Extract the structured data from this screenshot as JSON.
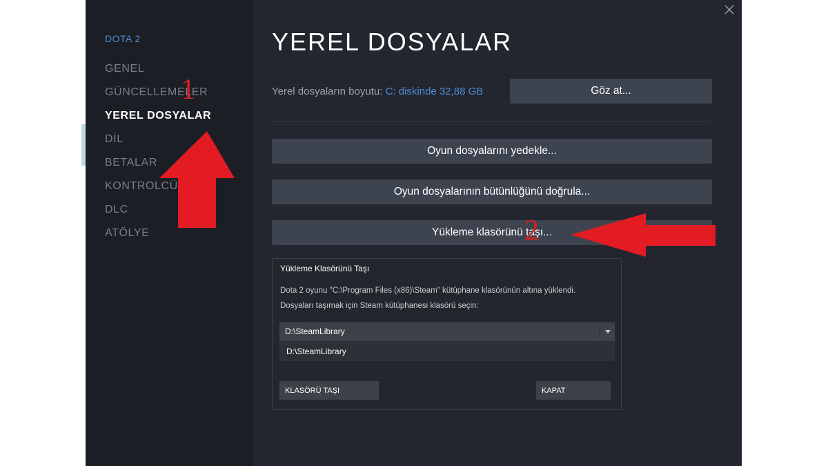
{
  "sidebar": {
    "game_name": "DOTA 2",
    "items": [
      {
        "label": "GENEL"
      },
      {
        "label": "GÜNCELLEMELER"
      },
      {
        "label": "YEREL DOSYALAR"
      },
      {
        "label": "DİL"
      },
      {
        "label": "BETALAR"
      },
      {
        "label": "KONTROLCÜ"
      },
      {
        "label": "DLC"
      },
      {
        "label": "ATÖLYE"
      }
    ]
  },
  "main": {
    "title": "YEREL DOSYALAR",
    "size_label": "Yerel dosyaların boyutu:",
    "size_value": "C: diskinde 32,88 GB",
    "browse_button": "Göz at...",
    "backup_button": "Oyun dosyalarını yedekle...",
    "verify_button": "Oyun dosyalarının bütünlüğünü doğrula...",
    "move_button": "Yükleme klasörünü taşı..."
  },
  "dialog": {
    "title": "Yükleme Klasörünü Taşı",
    "line1": "Dota 2 oyunu \"C:\\Program Files (x86)\\Steam\" kütüphane klasörünün altına yüklendi.",
    "line2": "Dosyaları taşımak için Steam kütüphanesi klasörü seçin:",
    "selected_library": "D:\\SteamLibrary",
    "options": [
      "D:\\SteamLibrary"
    ],
    "move_folder_button": "KLASÖRÜ TAŞI",
    "close_button": "KAPAT"
  },
  "annotations": {
    "step1": "1",
    "step2": "2",
    "arrow_color": "#e31b23"
  },
  "colors": {
    "accent_blue": "#4c8ed6",
    "window_bg": "#23262e",
    "sidebar_bg": "#1c1e25",
    "button_bg": "#3d4450"
  },
  "icons": {
    "close": "close-icon",
    "dropdown": "chevron-down-icon"
  }
}
